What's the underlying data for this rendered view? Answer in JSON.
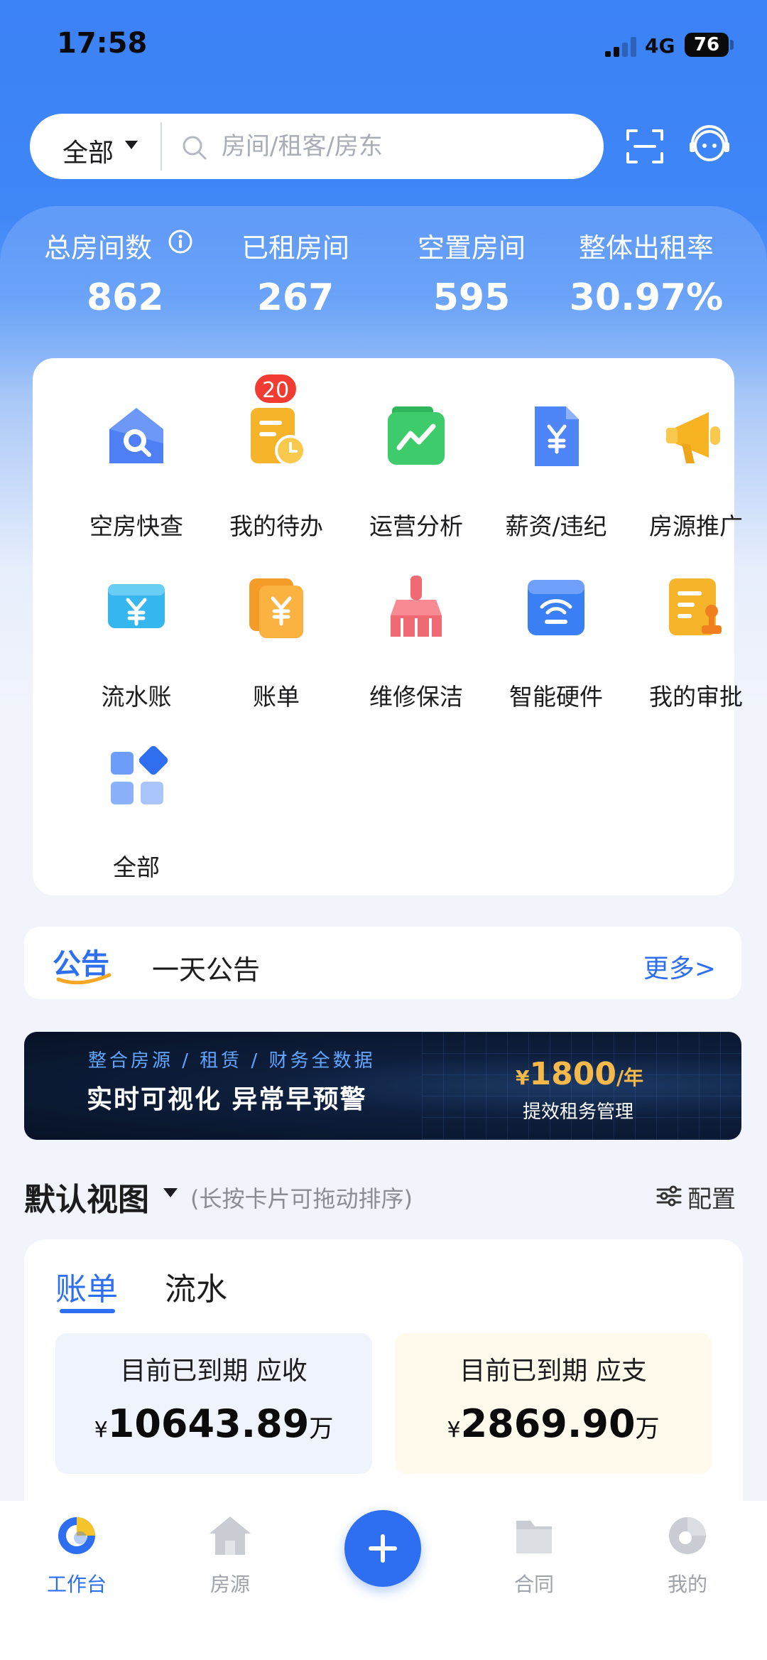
{
  "status_bar": {
    "time": "17:58",
    "network": "4G",
    "battery": "76"
  },
  "search": {
    "scope": "全部",
    "placeholder": "房间/租客/房东"
  },
  "stats": [
    {
      "label": "总房间数",
      "value": "862"
    },
    {
      "label": "已租房间",
      "value": "267"
    },
    {
      "label": "空置房间",
      "value": "595"
    },
    {
      "label": "整体出租率",
      "value": "30.97%"
    }
  ],
  "quick_menu": [
    {
      "label": "空房快查",
      "icon": "house-search-icon"
    },
    {
      "label": "我的待办",
      "icon": "todo-clock-icon",
      "badge": "20"
    },
    {
      "label": "运营分析",
      "icon": "trend-chart-icon"
    },
    {
      "label": "薪资/违纪",
      "icon": "salary-document-icon"
    },
    {
      "label": "房源推广",
      "icon": "megaphone-icon"
    },
    {
      "label": "流水账",
      "icon": "cash-flow-icon"
    },
    {
      "label": "账单",
      "icon": "bill-icon"
    },
    {
      "label": "维修保洁",
      "icon": "broom-icon"
    },
    {
      "label": "智能硬件",
      "icon": "smart-hardware-icon"
    },
    {
      "label": "我的审批",
      "icon": "approval-icon"
    },
    {
      "label": "全部",
      "icon": "all-apps-icon"
    }
  ],
  "notice": {
    "logo": "公告",
    "text": "一天公告",
    "more": "更多>"
  },
  "banner": {
    "line1": "整合房源 / 租赁 / 财务全数据",
    "line2": "实时可视化 异常早预警",
    "price_currency": "¥",
    "price": "1800",
    "price_unit": "/年",
    "sub": "提效租务管理"
  },
  "view": {
    "title": "默认视图",
    "hint": "(长按卡片可拖动排序)",
    "config_label": "配置"
  },
  "bill_card": {
    "tabs": [
      "账单",
      "流水"
    ],
    "receivable": {
      "title": "目前已到期 应收",
      "currency": "¥",
      "amount": "10643.89",
      "unit": "万"
    },
    "payable": {
      "title": "目前已到期 应支",
      "currency": "¥",
      "amount": "2869.90",
      "unit": "万"
    }
  },
  "bottom_nav": [
    {
      "label": "工作台",
      "icon": "workbench-icon"
    },
    {
      "label": "房源",
      "icon": "house-icon"
    },
    {
      "label": "合同",
      "icon": "contract-folder-icon"
    },
    {
      "label": "我的",
      "icon": "profile-icon"
    }
  ],
  "colors": {
    "primary": "#2d6ff0",
    "hero": "#3b82f6",
    "badge": "#f23b32",
    "payable_bg": "#fffaeb",
    "receivable_bg": "#eef3fc"
  }
}
